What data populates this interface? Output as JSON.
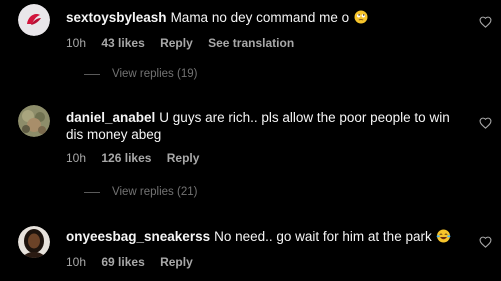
{
  "comments": [
    {
      "username": "sextoysbyleash",
      "text": "Mama no dey command me o",
      "emoji": "face-with-rolling-eyes",
      "time": "10h",
      "likes": "43 likes",
      "reply_label": "Reply",
      "translation_label": "See translation",
      "view_replies": "View replies (19)"
    },
    {
      "username": "daniel_anabel",
      "text": "U guys are rich.. pls allow the poor people to win dis money abeg",
      "time": "10h",
      "likes": "126 likes",
      "reply_label": "Reply",
      "view_replies": "View replies (21)"
    },
    {
      "username": "onyeesbag_sneakerss",
      "text": "No need.. go wait for him at the park",
      "emoji": "face-with-tears-of-joy",
      "time": "10h",
      "likes": "69 likes",
      "reply_label": "Reply"
    }
  ],
  "colors": {
    "background": "#000000",
    "primary_text": "#f5f5f5",
    "secondary_text": "#a8a8a8",
    "muted_text": "#737373"
  }
}
